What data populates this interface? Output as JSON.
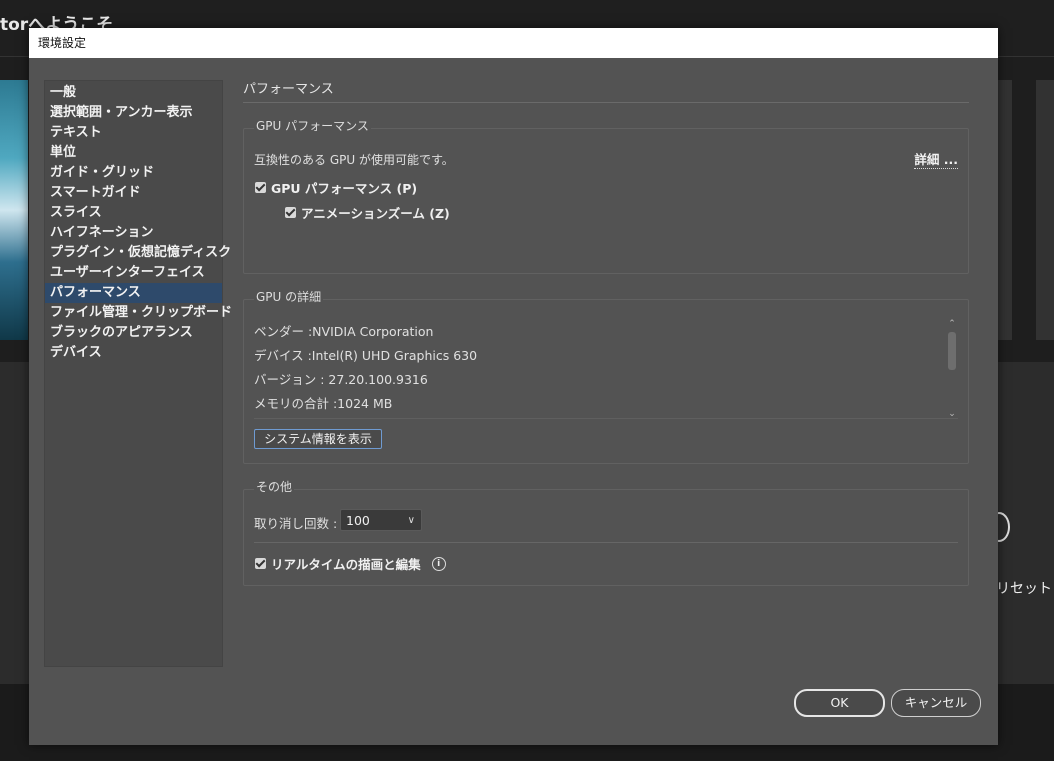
{
  "background": {
    "app_title": "torへようこそ",
    "reset_label": "リセット"
  },
  "dialog": {
    "title": "環境設定"
  },
  "sidebar": {
    "items": [
      {
        "label": "一般"
      },
      {
        "label": "選択範囲・アンカー表示"
      },
      {
        "label": "テキスト"
      },
      {
        "label": "単位"
      },
      {
        "label": "ガイド・グリッド"
      },
      {
        "label": "スマートガイド"
      },
      {
        "label": "スライス"
      },
      {
        "label": "ハイフネーション"
      },
      {
        "label": "プラグイン・仮想記憶ディスク"
      },
      {
        "label": "ユーザーインターフェイス"
      },
      {
        "label": "パフォーマンス",
        "selected": true
      },
      {
        "label": "ファイル管理・クリップボード"
      },
      {
        "label": "ブラックのアピアランス"
      },
      {
        "label": "デバイス"
      }
    ]
  },
  "main": {
    "section_title": "パフォーマンス",
    "gpu_performance": {
      "group_label": "GPU パフォーマンス",
      "status_text": "互換性のある GPU が使用可能です。",
      "details_link": "詳細 ...",
      "gpu_checkbox_label": "GPU パフォーマンス (P)",
      "gpu_checkbox_checked": true,
      "animation_zoom_label": "アニメーションズーム (Z)",
      "animation_zoom_checked": true
    },
    "gpu_details": {
      "group_label": "GPU の詳細",
      "lines": [
        "ベンダー :NVIDIA Corporation",
        "デバイス :Intel(R) UHD Graphics 630",
        "バージョン : 27.20.100.9316",
        "メモリの合計 :1024 MB"
      ],
      "system_info_button": "システム情報を表示"
    },
    "other": {
      "group_label": "その他",
      "undo_label": "取り消し回数 :",
      "undo_value": "100",
      "realtime_label": "リアルタイムの描画と編集",
      "realtime_checked": true
    }
  },
  "footer": {
    "ok_label": "OK",
    "cancel_label": "キャンセル"
  },
  "colors": {
    "dialog_bg": "#535353",
    "selection": "#2e4a6b",
    "button_focus_border": "#6f9bd2"
  }
}
